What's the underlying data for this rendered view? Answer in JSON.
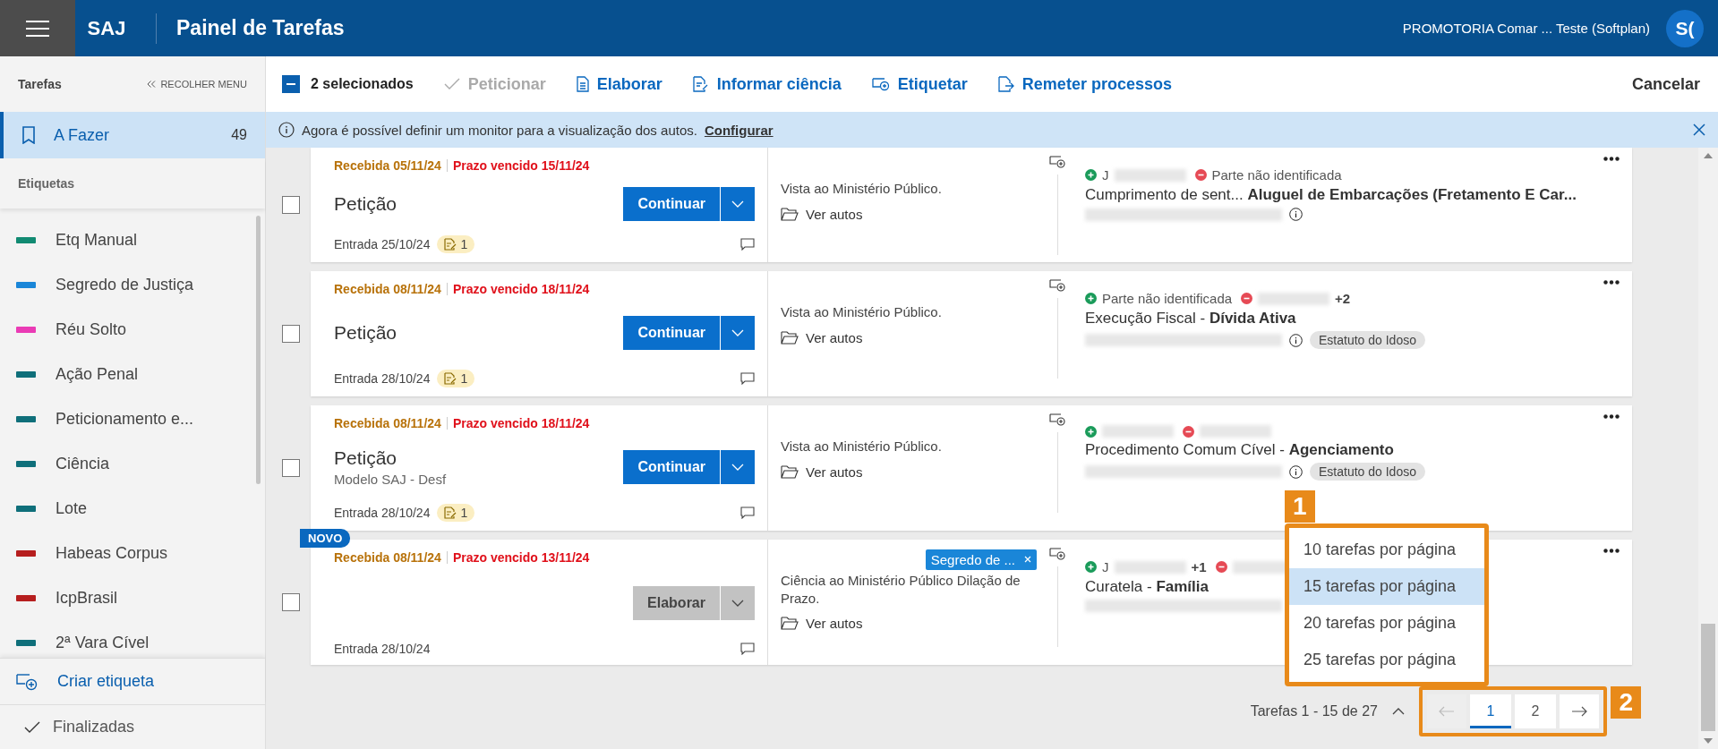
{
  "header": {
    "logo": "SAJ",
    "title": "Painel de Tarefas",
    "user": "PROMOTORIA Comar ... Teste (Softplan)",
    "avatar": "S("
  },
  "toolbar": {
    "selection": {
      "label": "2 selecionados",
      "checked": true
    },
    "actions": [
      {
        "label": "Peticionar",
        "kind": "check",
        "disabled": true
      },
      {
        "label": "Elaborar",
        "kind": "doc",
        "disabled": false
      },
      {
        "label": "Informar ciência",
        "kind": "doc-edit",
        "disabled": false
      },
      {
        "label": "Etiquetar",
        "kind": "tag",
        "disabled": false
      },
      {
        "label": "Remeter processos",
        "kind": "send",
        "disabled": false
      }
    ],
    "cancel": "Cancelar"
  },
  "info_bar": {
    "text": "Agora é possível definir um monitor para a visualização dos autos.",
    "link": "Configurar"
  },
  "sidebar": {
    "heading": "Tarefas",
    "collapse": "RECOLHER MENU",
    "items": [
      {
        "label": "A Fazer",
        "count": "49",
        "selected": true
      }
    ],
    "tags_heading": "Etiquetas",
    "tags": [
      {
        "label": "Etq Manual",
        "color": "#118a72"
      },
      {
        "label": "Segredo de Justiça",
        "color": "#1a86d8"
      },
      {
        "label": "Réu Solto",
        "color": "#ea3bb5"
      },
      {
        "label": "Ação Penal",
        "color": "#0f6f7a"
      },
      {
        "label": "Peticionamento e...",
        "color": "#0f6f7a"
      },
      {
        "label": "Ciência",
        "color": "#0f6f7a"
      },
      {
        "label": "Lote",
        "color": "#0f6f7a"
      },
      {
        "label": "Habeas Corpus",
        "color": "#b61e1e"
      },
      {
        "label": "IcpBrasil",
        "color": "#b61e1e"
      },
      {
        "label": "2ª Vara Cível",
        "color": "#0f6f7a"
      }
    ],
    "create": "Criar etiqueta",
    "finished": "Finalizadas"
  },
  "cards": [
    {
      "checked": false,
      "received": "Recebida 05/11/24",
      "deadline": "Prazo vencido 15/11/24",
      "title": "Petição",
      "action": {
        "label": "Continuar",
        "kind": "primary"
      },
      "entry": "Entrada 25/10/24",
      "docs": "1",
      "description": "Vista ao Ministério Público.",
      "open": "Ver autos",
      "parties": [
        {
          "kind": "plus",
          "text": "J",
          "redacted": true
        },
        {
          "kind": "minus",
          "text": "Parte não identificada"
        }
      ],
      "subject": "Cumprimento de sent... **Aluguel de Embarcações (Fretamento E Car...**",
      "info": true
    },
    {
      "checked": false,
      "received": "Recebida 08/11/24",
      "deadline": "Prazo vencido 18/11/24",
      "title": "Petição",
      "action": {
        "label": "Continuar",
        "kind": "primary"
      },
      "entry": "Entrada 28/10/24",
      "docs": "1",
      "description": "Vista ao Ministério Público.",
      "open": "Ver autos",
      "parties": [
        {
          "kind": "plus",
          "text": "Parte não identificada"
        },
        {
          "kind": "minus",
          "redacted": true,
          "extra": "+2"
        }
      ],
      "subject": "Execução Fiscal - **Dívida Ativa**",
      "info": true,
      "badge": "Estatuto do Idoso"
    },
    {
      "checked": false,
      "received": "Recebida 08/11/24",
      "deadline": "Prazo vencido 18/11/24",
      "title": "Petição",
      "subtitle": "Modelo SAJ - Desf",
      "action": {
        "label": "Continuar",
        "kind": "primary"
      },
      "entry": "Entrada 28/10/24",
      "docs": "1",
      "description": "Vista ao Ministério Público.",
      "open": "Ver autos",
      "parties": [
        {
          "kind": "plus",
          "redacted": true
        },
        {
          "kind": "minus",
          "redacted": true
        }
      ],
      "subject": "Procedimento Comum Cível - **Agenciamento**",
      "info": true,
      "badge": "Estatuto do Idoso"
    },
    {
      "checked": false,
      "new": "NOVO",
      "received": "Recebida 08/11/24",
      "deadline": "Prazo vencido 13/11/24",
      "tag": {
        "label": "Segredo de ...",
        "color": "#1a86d8"
      },
      "action": {
        "label": "Elaborar",
        "kind": "secondary"
      },
      "entry": "Entrada 28/10/24",
      "description": "Ciência ao Ministério Público Dilação de Prazo.",
      "open": "Ver autos",
      "parties": [
        {
          "kind": "plus",
          "text": "J",
          "redacted": true,
          "extra": "+1"
        },
        {
          "kind": "minus",
          "redacted": true
        }
      ],
      "subject": "Curatela - **Família**",
      "info": false
    }
  ],
  "page_size_menu": {
    "open": true,
    "callout": "1",
    "options": [
      {
        "label": "10 tarefas por página",
        "selected": false
      },
      {
        "label": "15 tarefas por página",
        "selected": true
      },
      {
        "label": "20 tarefas por página",
        "selected": false
      },
      {
        "label": "25 tarefas por página",
        "selected": false
      }
    ]
  },
  "pagination": {
    "summary": "Tarefas 1 - 15 de 27",
    "callout": "2",
    "prev_disabled": true,
    "next_disabled": false,
    "pages": [
      {
        "label": "1",
        "selected": true
      },
      {
        "label": "2",
        "selected": false
      }
    ]
  }
}
